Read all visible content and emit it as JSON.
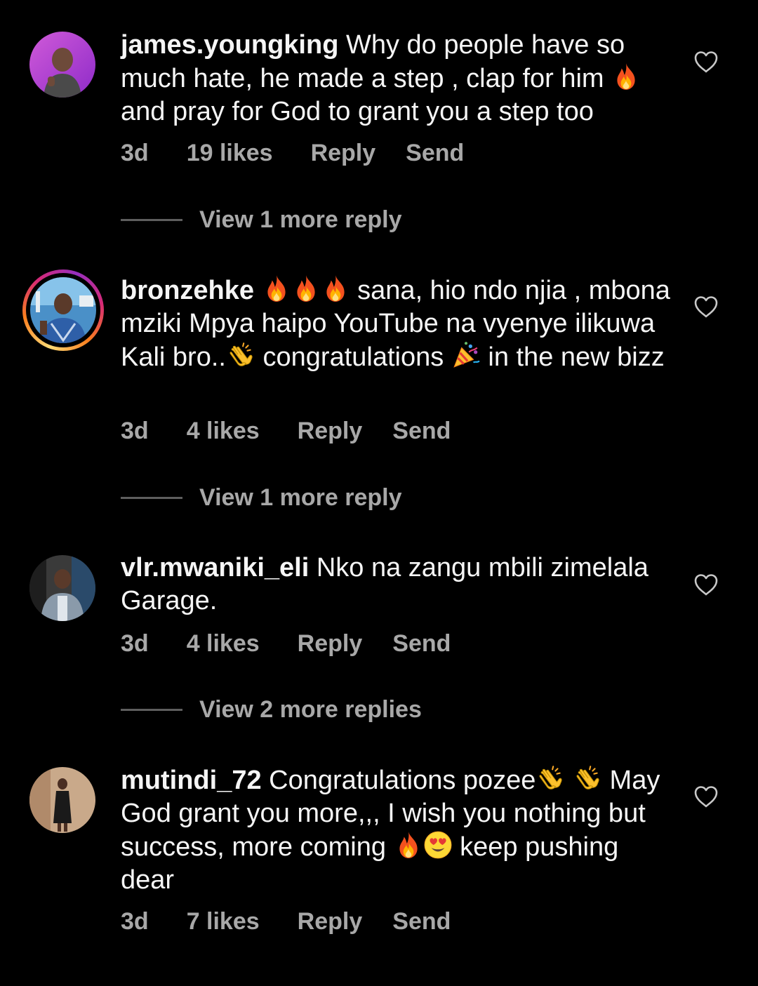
{
  "comments": [
    {
      "username": "james.youngking",
      "text_1": " Why do people have so much hate, he made a step , clap for him ",
      "text_2": " and pray for God to grant you a step too",
      "time": "3d",
      "likes": "19 likes",
      "reply": "Reply",
      "send": "Send",
      "view_more": "View 1 more reply"
    },
    {
      "username": "bronzehke",
      "text_1": " sana, hio ndo njia , mbona mziki Mpya haipo YouTube na vyenye ilikuwa Kali bro..",
      "text_2": " congratulations ",
      "text_3": " in the new bizz",
      "time": "3d",
      "likes": "4 likes",
      "reply": "Reply",
      "send": "Send",
      "view_more": "View 1 more reply"
    },
    {
      "username": "vlr.mwaniki_eli",
      "text_1": " Nko na zangu mbili zimelala Garage.",
      "time": "3d",
      "likes": "4 likes",
      "reply": "Reply",
      "send": "Send",
      "view_more": "View 2 more replies"
    },
    {
      "username": "mutindi_72",
      "text_1": " Congratulations pozee",
      "text_2": " May God grant you more,,, I wish you nothing but success, more coming ",
      "text_3": " keep pushing dear",
      "time": "3d",
      "likes": "7 likes",
      "reply": "Reply",
      "send": "Send"
    }
  ],
  "icons": {
    "like": "heart-outline-icon",
    "fire": "fire-emoji",
    "clap": "clapping-hands-emoji",
    "party": "party-popper-emoji",
    "love": "heart-eyes-emoji"
  },
  "colors": {
    "background": "#000000",
    "text": "#f5f5f5",
    "secondary": "#a8a8a8",
    "divider": "#5e5e5e"
  }
}
